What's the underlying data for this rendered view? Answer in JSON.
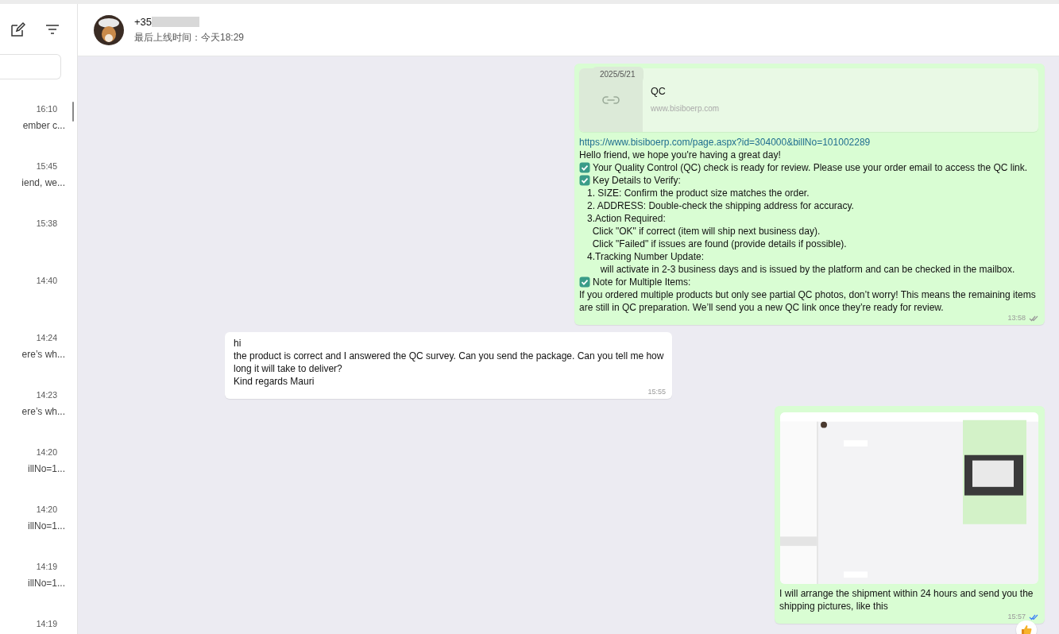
{
  "sidebar": {
    "chats": [
      {
        "time": "16:10",
        "preview": "ember c..."
      },
      {
        "time": "15:45",
        "preview": "iend, we..."
      },
      {
        "time": "15:38"
      },
      {
        "time": "14:40"
      },
      {
        "time": "14:24",
        "preview": "ere’s wh..."
      },
      {
        "time": "14:23",
        "preview": "ere’s wh..."
      },
      {
        "time": "14:20",
        "preview": "illNo=1..."
      },
      {
        "time": "14:20",
        "preview": "illNo=1..."
      },
      {
        "time": "14:19",
        "preview": "illNo=1..."
      },
      {
        "time": "14:19"
      }
    ]
  },
  "header": {
    "name": "+35",
    "status": "最后上线时间：今天18:29"
  },
  "date_chip": "2025/5/21",
  "messages": [
    {
      "kind": "link",
      "outgoing": true,
      "preview": {
        "title": "QC",
        "domain": "www.bisiboerp.com"
      },
      "link": "https://www.bisiboerp.com/page.aspx?id=304000&billNo=101002289",
      "lines": [
        {
          "kind": "plain",
          "text": "Hello friend, we hope you're having a great day!"
        },
        {
          "kind": "check",
          "text": "Your Quality Control (QC) check is ready for review. Please use your order email to access the QC link."
        },
        {
          "kind": "check",
          "text": "Key Details to Verify:"
        },
        {
          "kind": "plain",
          "text": "   1. SIZE: Confirm the product size matches the order."
        },
        {
          "kind": "plain",
          "text": "   2. ADDRESS: Double-check the shipping address for accuracy."
        },
        {
          "kind": "plain",
          "text": "   3.Action Required:"
        },
        {
          "kind": "plain",
          "text": "     Click \"OK\" if correct (item will ship next business day)."
        },
        {
          "kind": "plain",
          "text": "     Click \"Failed\" if issues are found (provide details if possible)."
        },
        {
          "kind": "plain",
          "text": "   4.Tracking Number Update:"
        },
        {
          "kind": "plain",
          "text": "        will activate in 2-3 business days and is issued by the platform and can be checked in the mailbox."
        },
        {
          "kind": "check",
          "text": "Note for Multiple Items:"
        },
        {
          "kind": "plain",
          "text": "If you ordered multiple products but only see partial QC photos, don’t worry! This means the remaining items are still in QC preparation. We’ll send you a new QC link once they’re ready for review."
        }
      ],
      "time": "13:58",
      "read": false
    },
    {
      "kind": "text",
      "outgoing": false,
      "lines": [
        {
          "kind": "plain",
          "text": "hi"
        },
        {
          "kind": "plain",
          "text": "the product is correct and I answered the QC survey. Can you send the package. Can you tell me how long it will take to deliver?"
        },
        {
          "kind": "plain",
          "text": "Kind regards Mauri"
        }
      ],
      "time": "15:55"
    },
    {
      "outgoing": true,
      "lines": [
        {
          "kind": "plain",
          "text": "I will arrange the shipment within 24 hours and send you the shipping pictures, like this"
        }
      ],
      "time": "15:57",
      "read": true,
      "reaction": true
    }
  ]
}
